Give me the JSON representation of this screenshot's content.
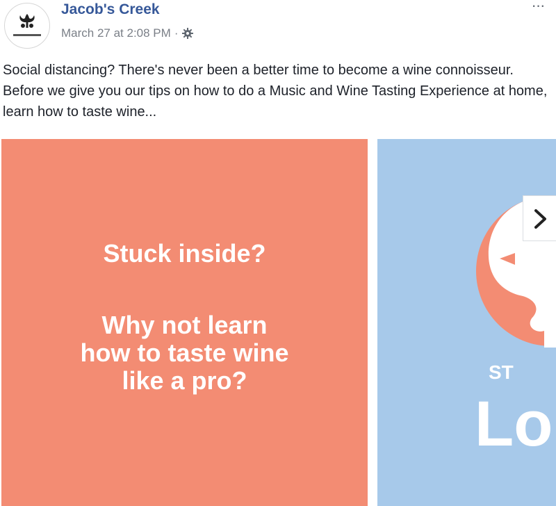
{
  "post": {
    "page_name": "Jacob's Creek",
    "timestamp": "March 27 at 2:08 PM",
    "separator": "·",
    "privacy_icon": "gear-icon",
    "more_label": "···",
    "text": "Social distancing? There's never been a better time to become a wine connoisseur. Before we give you our tips on how to do a Music and Wine Tasting Experience at home, learn how to taste wine..."
  },
  "carousel": {
    "card1": {
      "line1": "Stuck inside?",
      "line2": "Why not learn",
      "line3": "how to taste wine",
      "line4": "like a pro?",
      "background": "#f38c73"
    },
    "card2": {
      "small_text": "ST",
      "big_text": "Lo",
      "background": "#a7c9ea"
    },
    "next_icon": "chevron-right-icon"
  },
  "colors": {
    "link": "#365899",
    "meta": "#7a7f87",
    "text": "#1d2129"
  }
}
